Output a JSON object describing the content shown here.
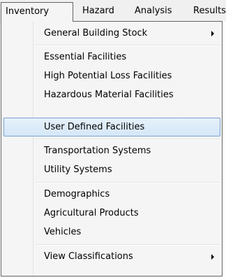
{
  "menubar": {
    "items": [
      {
        "label": "Inventory"
      },
      {
        "label": "Hazard"
      },
      {
        "label": "Analysis"
      },
      {
        "label": "Results"
      }
    ]
  },
  "dropdown": {
    "items": [
      {
        "label": "General Building Stock",
        "submenu": true
      },
      {
        "label": "Essential Facilities"
      },
      {
        "label": "High Potential Loss Facilities"
      },
      {
        "label": "Hazardous Material Facilities"
      },
      {
        "label": "User Defined Facilities",
        "highlighted": true
      },
      {
        "label": "Transportation Systems"
      },
      {
        "label": "Utility Systems"
      },
      {
        "label": "Demographics"
      },
      {
        "label": "Agricultural Products"
      },
      {
        "label": "Vehicles"
      },
      {
        "label": "View Classifications",
        "submenu": true
      }
    ]
  },
  "colors": {
    "menu_background": "#f5f5f5",
    "menu_border": "#646464",
    "highlight_fill": "#d5e7f8",
    "highlight_border": "#7da2ce"
  }
}
